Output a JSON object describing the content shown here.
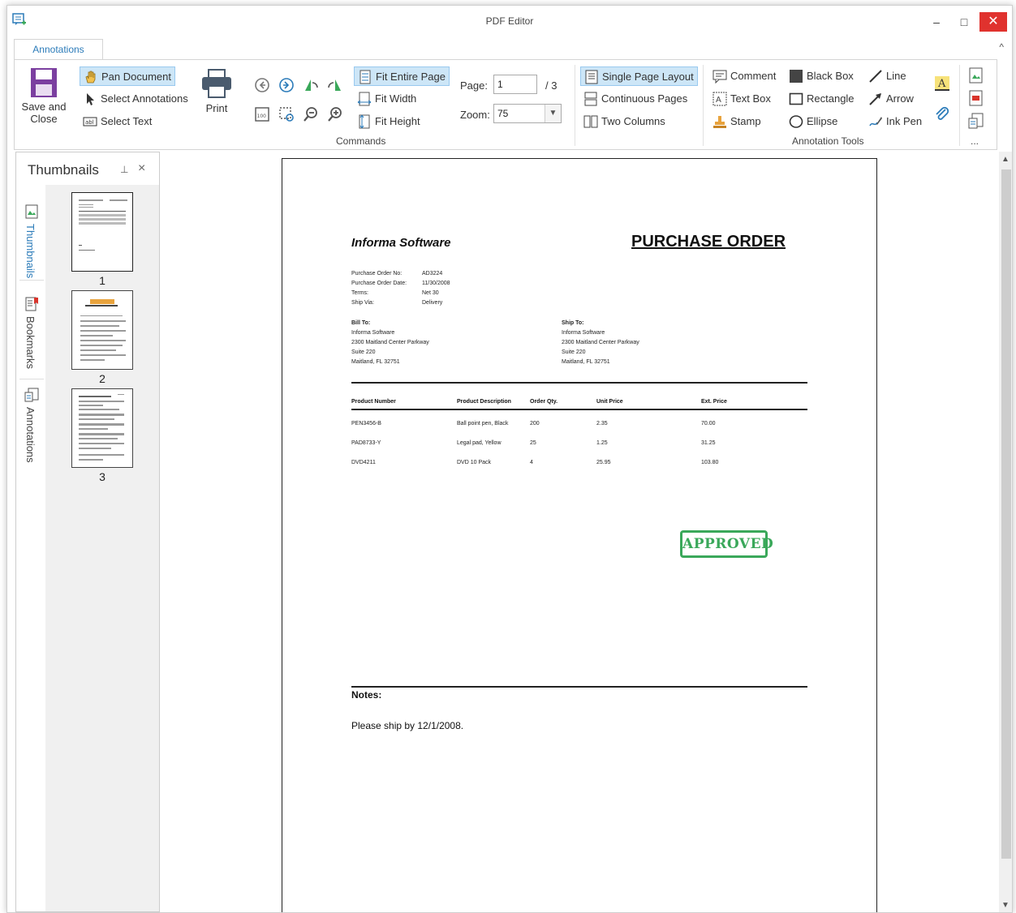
{
  "window": {
    "title": "PDF Editor",
    "minimize": "–",
    "maximize": "□",
    "close": "✕"
  },
  "ribbon": {
    "tab": "Annotations",
    "collapse": "^",
    "save_close": "Save and\nClose",
    "pan_document": "Pan Document",
    "select_annotations": "Select Annotations",
    "select_text": "Select Text",
    "print": "Print",
    "fit_entire_page": "Fit Entire Page",
    "fit_width": "Fit Width",
    "fit_height": "Fit Height",
    "page_label": "Page:",
    "page_value": "1",
    "page_total": "/ 3",
    "zoom_label": "Zoom:",
    "zoom_value": "75",
    "commands_label": "Commands",
    "single_page": "Single Page Layout",
    "continuous": "Continuous Pages",
    "two_columns": "Two Columns",
    "comment": "Comment",
    "text_box": "Text Box",
    "stamp": "Stamp",
    "black_box": "Black Box",
    "rectangle": "Rectangle",
    "ellipse": "Ellipse",
    "line": "Line",
    "arrow": "Arrow",
    "ink_pen": "Ink Pen",
    "annotation_tools_label": "Annotation Tools",
    "more": "..."
  },
  "panel": {
    "title": "Thumbnails",
    "pin": "📌",
    "close": "×",
    "tabs": [
      "Thumbnails",
      "Bookmarks",
      "Annotations"
    ],
    "pages": [
      "1",
      "2",
      "3"
    ]
  },
  "document": {
    "company": "Informa Software",
    "title": "PURCHASE ORDER",
    "meta_labels": [
      "Purchase Order No:",
      "Purchase Order Date:",
      "Terms:",
      "Ship Via:"
    ],
    "meta_values": [
      "AD3224",
      "11/30/2008",
      "Net 30",
      "Delivery"
    ],
    "bill_to": {
      "heading": "Bill To:",
      "lines": [
        "Informa Software",
        "2300 Maitland Center Parkway",
        "Suite 220",
        "Maitland, FL  32751"
      ]
    },
    "ship_to": {
      "heading": "Ship To:",
      "lines": [
        "Informa Software",
        "2300 Maitland Center Parkway",
        "Suite 220",
        "Maitland, FL  32751"
      ]
    },
    "columns": [
      "Product Number",
      "Product Description",
      "Order Qty.",
      "Unit Price",
      "Ext. Price"
    ],
    "rows": [
      [
        "PEN3456-B",
        "Ball point pen, Black",
        "200",
        "2.35",
        "70.00"
      ],
      [
        "PAD8733-Y",
        "Legal pad, Yellow",
        "25",
        "1.25",
        "31.25"
      ],
      [
        "DVD4211",
        "DVD 10 Pack",
        "4",
        "25.95",
        "103.80"
      ]
    ],
    "stamp": "APPROVED",
    "notes_label": "Notes:",
    "notes_text": "Please ship by 12/1/2008."
  },
  "colors": {
    "accent": "#2b7bb9",
    "active_bg": "#cde6f7",
    "stamp_green": "#3aa85a",
    "close_red": "#e0322e",
    "save_purple": "#7b3fa0"
  }
}
